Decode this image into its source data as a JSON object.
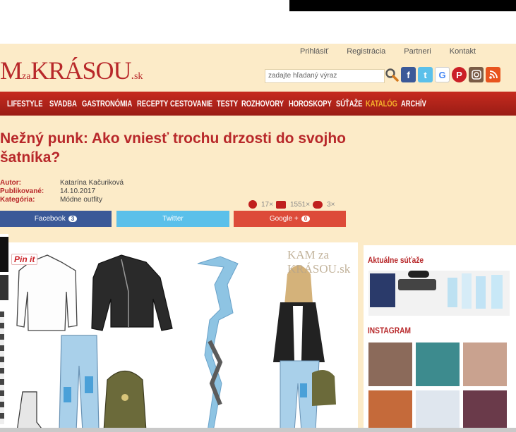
{
  "topnav": {
    "links": [
      "Prihlásiť",
      "Registrácia",
      "Partneri",
      "Kontakt"
    ]
  },
  "logo": {
    "prefix": "M",
    "small": "za",
    "brand": "KRÁSOU",
    "dot": ".",
    "tld": "sk"
  },
  "search": {
    "placeholder": "zadajte hľadaný výraz"
  },
  "social_icons": [
    "search-icon",
    "facebook-icon",
    "twitter-icon",
    "google-icon",
    "pinterest-icon",
    "instagram-icon",
    "rss-icon"
  ],
  "nav": {
    "items": [
      "LIFESTYLE",
      "SVADBA",
      "GASTRONÓMIA",
      "RECEPTY",
      "CESTOVANIE",
      "TESTY",
      "ROZHOVORY",
      "HOROSKOPY",
      "SÚŤAŽE",
      "KATALÓG",
      "ARCHÍV"
    ],
    "highlighted": "KATALÓG"
  },
  "article": {
    "title_line1": "Nežný punk: Ako vniesť trochu drzosti do svojho",
    "title_line2": "šatníka?",
    "author_label": "Autor:",
    "author": "Katarína Kačuriková",
    "published_label": "Publikované:",
    "published": "14.10.2017",
    "category_label": "Kategória:",
    "category": "Módne outfity",
    "stats": {
      "likes": "17×",
      "views": "1551×",
      "comments": "3×"
    }
  },
  "share": {
    "facebook_label": "Facebook",
    "facebook_count": "3",
    "twitter_label": "Twitter",
    "google_label": "Google +",
    "google_count": "0"
  },
  "image": {
    "pin_label": "Pin it",
    "watermark": "KAM za KRÁSOU.sk"
  },
  "sidebar": {
    "contests_title": "Aktuálne súťaže",
    "instagram_title": "INSTAGRAM"
  },
  "colors": {
    "brand_red": "#b8282a",
    "nav_red": "#c62b1f",
    "header_bg": "#fcebc8",
    "catalog_orange": "#f5b22b",
    "facebook_blue": "#3b5998",
    "twitter_blue": "#5bc0ea",
    "google_red": "#dd4b39"
  }
}
